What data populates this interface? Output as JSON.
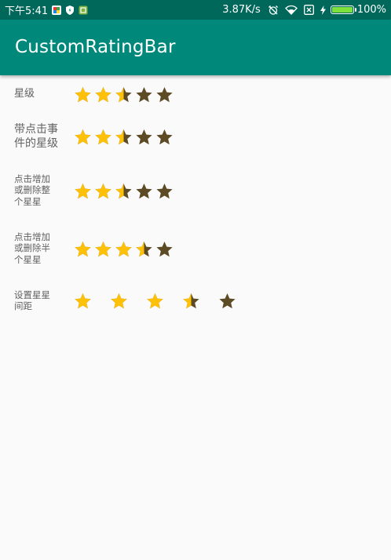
{
  "status_bar": {
    "time": "下午5:41",
    "net_speed": "3.87K/s",
    "battery": "100%",
    "icons": [
      "gallery-app-icon",
      "shield-icon",
      "app-icon",
      "alarm-off-icon",
      "wifi-icon",
      "sim-off-icon",
      "charging-bolt-icon",
      "battery-icon"
    ]
  },
  "app_bar": {
    "title": "CustomRatingBar"
  },
  "colors": {
    "status_bar": "#00685b",
    "app_bar": "#00897b",
    "star_full": "#ffc107",
    "star_empty": "#5d4b26"
  },
  "rating_rows": [
    {
      "label": "星级",
      "rating": 2.5,
      "max": 5
    },
    {
      "label": "带点击事\n件的星级",
      "rating": 2.5,
      "max": 5
    },
    {
      "label": "点击增加\n或删除整\n个星星",
      "rating": 2.5,
      "max": 5
    },
    {
      "label": "点击增加\n或删除半\n个星星",
      "rating": 3.5,
      "max": 5
    },
    {
      "label": "设置星星\n间距",
      "rating": 3.5,
      "max": 5
    }
  ]
}
